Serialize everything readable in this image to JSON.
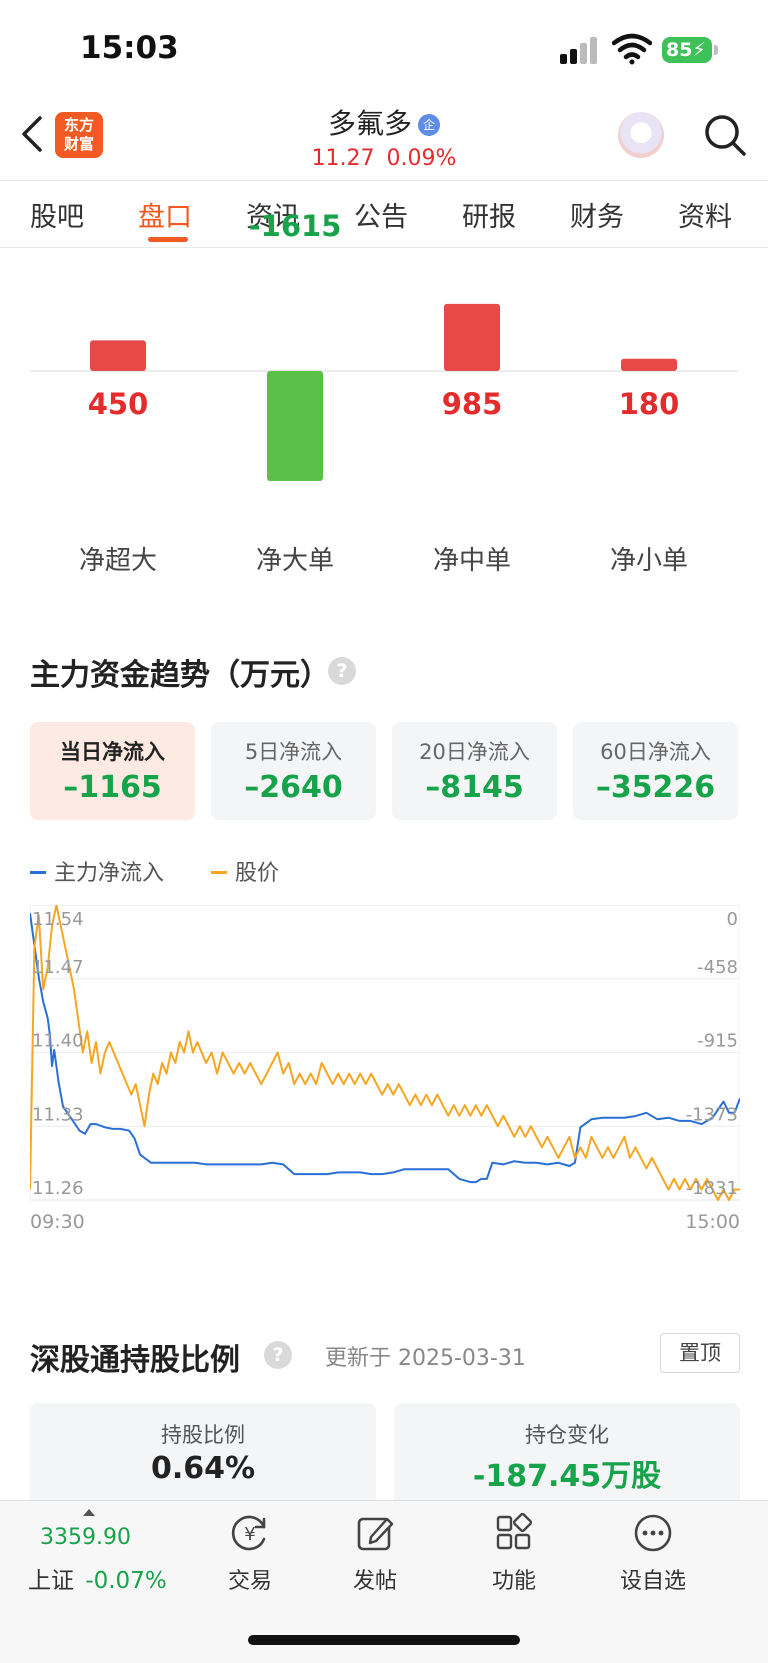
{
  "status_bar": {
    "time": "15:03",
    "battery": "85"
  },
  "header": {
    "logo_text_line1": "东方",
    "logo_text_line2": "财富",
    "stock_name": "多氟多",
    "badge": "企",
    "price": "11.27",
    "change_pct": "0.09%"
  },
  "tabs": [
    "股吧",
    "盘口",
    "资讯",
    "公告",
    "研报",
    "财务",
    "资料"
  ],
  "active_tab": "盘口",
  "order_flow": {
    "items": [
      {
        "label": "净超大",
        "value": "450"
      },
      {
        "label": "净大单",
        "value": "-1615"
      },
      {
        "label": "净中单",
        "value": "985"
      },
      {
        "label": "净小单",
        "value": "180"
      }
    ],
    "colors": {
      "positive": "#e84848",
      "negative": "#5cbf48"
    }
  },
  "trend": {
    "title": "主力资金趋势（万元）",
    "help": "?",
    "cards": [
      {
        "label": "当日净流入",
        "value": "–1165"
      },
      {
        "label": "5日净流入",
        "value": "–2640"
      },
      {
        "label": "20日净流入",
        "value": "–8145"
      },
      {
        "label": "60日净流入",
        "value": "–35226"
      }
    ],
    "legend": {
      "flow": "主力净流入",
      "price": "股价"
    }
  },
  "chart_data": {
    "type": "line",
    "x_start": "09:30",
    "x_end": "15:00",
    "left_axis_ticks": [
      "11.54",
      "11.47",
      "11.40",
      "11.33",
      "11.26"
    ],
    "right_axis_ticks": [
      "0",
      "-458",
      "-915",
      "-1373",
      "-1831"
    ],
    "y_left_range": [
      11.26,
      11.54
    ],
    "y_right_range": [
      -1831,
      0
    ],
    "series": [
      {
        "name": "主力净流入",
        "color": "#2a6fd6",
        "axis": "right",
        "points": [
          [
            0,
            -50
          ],
          [
            4,
            -250
          ],
          [
            8,
            -450
          ],
          [
            12,
            -600
          ],
          [
            16,
            -700
          ],
          [
            18,
            -800
          ],
          [
            20,
            -1000
          ],
          [
            22,
            -900
          ],
          [
            26,
            -1100
          ],
          [
            30,
            -1250
          ],
          [
            35,
            -1300
          ],
          [
            40,
            -1350
          ],
          [
            45,
            -1400
          ],
          [
            50,
            -1420
          ],
          [
            55,
            -1360
          ],
          [
            60,
            -1360
          ],
          [
            68,
            -1380
          ],
          [
            75,
            -1390
          ],
          [
            82,
            -1390
          ],
          [
            90,
            -1400
          ],
          [
            95,
            -1450
          ],
          [
            100,
            -1550
          ],
          [
            110,
            -1600
          ],
          [
            120,
            -1600
          ],
          [
            130,
            -1600
          ],
          [
            140,
            -1600
          ],
          [
            150,
            -1600
          ],
          [
            160,
            -1610
          ],
          [
            170,
            -1610
          ],
          [
            180,
            -1610
          ],
          [
            190,
            -1610
          ],
          [
            200,
            -1610
          ],
          [
            210,
            -1610
          ],
          [
            220,
            -1600
          ],
          [
            230,
            -1610
          ],
          [
            240,
            -1670
          ],
          [
            250,
            -1670
          ],
          [
            260,
            -1670
          ],
          [
            270,
            -1670
          ],
          [
            280,
            -1660
          ],
          [
            290,
            -1660
          ],
          [
            300,
            -1660
          ],
          [
            310,
            -1670
          ],
          [
            320,
            -1670
          ],
          [
            330,
            -1660
          ],
          [
            340,
            -1640
          ],
          [
            350,
            -1640
          ],
          [
            360,
            -1640
          ],
          [
            370,
            -1640
          ],
          [
            380,
            -1640
          ],
          [
            390,
            -1700
          ],
          [
            400,
            -1720
          ],
          [
            405,
            -1720
          ],
          [
            410,
            -1700
          ],
          [
            415,
            -1700
          ],
          [
            420,
            -1600
          ],
          [
            430,
            -1610
          ],
          [
            440,
            -1590
          ],
          [
            450,
            -1600
          ],
          [
            460,
            -1600
          ],
          [
            470,
            -1610
          ],
          [
            480,
            -1600
          ],
          [
            490,
            -1620
          ],
          [
            495,
            -1600
          ],
          [
            500,
            -1380
          ],
          [
            510,
            -1330
          ],
          [
            520,
            -1320
          ],
          [
            530,
            -1320
          ],
          [
            540,
            -1320
          ],
          [
            550,
            -1310
          ],
          [
            560,
            -1290
          ],
          [
            570,
            -1330
          ],
          [
            580,
            -1320
          ],
          [
            590,
            -1340
          ],
          [
            600,
            -1340
          ],
          [
            610,
            -1360
          ],
          [
            620,
            -1320
          ],
          [
            625,
            -1270
          ],
          [
            630,
            -1220
          ],
          [
            635,
            -1290
          ],
          [
            640,
            -1290
          ],
          [
            645,
            -1200
          ]
        ]
      },
      {
        "name": "股价",
        "color": "#f5a623",
        "axis": "left",
        "points": [
          [
            0,
            11.27
          ],
          [
            4,
            11.5
          ],
          [
            8,
            11.53
          ],
          [
            12,
            11.46
          ],
          [
            16,
            11.48
          ],
          [
            20,
            11.52
          ],
          [
            24,
            11.55
          ],
          [
            28,
            11.52
          ],
          [
            32,
            11.5
          ],
          [
            36,
            11.48
          ],
          [
            40,
            11.46
          ],
          [
            44,
            11.43
          ],
          [
            48,
            11.4
          ],
          [
            52,
            11.42
          ],
          [
            56,
            11.39
          ],
          [
            60,
            11.41
          ],
          [
            64,
            11.38
          ],
          [
            68,
            11.4
          ],
          [
            72,
            11.41
          ],
          [
            76,
            11.4
          ],
          [
            80,
            11.39
          ],
          [
            84,
            11.38
          ],
          [
            88,
            11.37
          ],
          [
            92,
            11.36
          ],
          [
            96,
            11.37
          ],
          [
            100,
            11.35
          ],
          [
            104,
            11.33
          ],
          [
            108,
            11.36
          ],
          [
            112,
            11.38
          ],
          [
            116,
            11.37
          ],
          [
            120,
            11.39
          ],
          [
            124,
            11.38
          ],
          [
            128,
            11.4
          ],
          [
            132,
            11.39
          ],
          [
            136,
            11.41
          ],
          [
            140,
            11.4
          ],
          [
            144,
            11.42
          ],
          [
            148,
            11.4
          ],
          [
            152,
            11.41
          ],
          [
            156,
            11.4
          ],
          [
            160,
            11.39
          ],
          [
            165,
            11.4
          ],
          [
            170,
            11.38
          ],
          [
            175,
            11.4
          ],
          [
            180,
            11.39
          ],
          [
            185,
            11.38
          ],
          [
            190,
            11.39
          ],
          [
            195,
            11.38
          ],
          [
            200,
            11.39
          ],
          [
            205,
            11.38
          ],
          [
            210,
            11.37
          ],
          [
            215,
            11.38
          ],
          [
            220,
            11.39
          ],
          [
            225,
            11.4
          ],
          [
            230,
            11.38
          ],
          [
            235,
            11.39
          ],
          [
            240,
            11.37
          ],
          [
            245,
            11.38
          ],
          [
            250,
            11.37
          ],
          [
            255,
            11.38
          ],
          [
            260,
            11.37
          ],
          [
            265,
            11.39
          ],
          [
            270,
            11.38
          ],
          [
            275,
            11.37
          ],
          [
            280,
            11.38
          ],
          [
            285,
            11.37
          ],
          [
            290,
            11.38
          ],
          [
            295,
            11.37
          ],
          [
            300,
            11.38
          ],
          [
            305,
            11.37
          ],
          [
            310,
            11.38
          ],
          [
            315,
            11.37
          ],
          [
            320,
            11.36
          ],
          [
            325,
            11.37
          ],
          [
            330,
            11.36
          ],
          [
            335,
            11.37
          ],
          [
            340,
            11.36
          ],
          [
            345,
            11.35
          ],
          [
            350,
            11.36
          ],
          [
            355,
            11.35
          ],
          [
            360,
            11.36
          ],
          [
            365,
            11.35
          ],
          [
            370,
            11.36
          ],
          [
            375,
            11.35
          ],
          [
            380,
            11.34
          ],
          [
            385,
            11.35
          ],
          [
            390,
            11.34
          ],
          [
            395,
            11.35
          ],
          [
            400,
            11.34
          ],
          [
            405,
            11.35
          ],
          [
            410,
            11.34
          ],
          [
            415,
            11.35
          ],
          [
            420,
            11.34
          ],
          [
            425,
            11.33
          ],
          [
            430,
            11.34
          ],
          [
            435,
            11.33
          ],
          [
            440,
            11.32
          ],
          [
            445,
            11.33
          ],
          [
            450,
            11.32
          ],
          [
            455,
            11.33
          ],
          [
            460,
            11.32
          ],
          [
            465,
            11.31
          ],
          [
            470,
            11.32
          ],
          [
            475,
            11.31
          ],
          [
            480,
            11.3
          ],
          [
            485,
            11.31
          ],
          [
            490,
            11.32
          ],
          [
            495,
            11.3
          ],
          [
            500,
            11.31
          ],
          [
            505,
            11.3
          ],
          [
            510,
            11.32
          ],
          [
            515,
            11.31
          ],
          [
            520,
            11.3
          ],
          [
            525,
            11.31
          ],
          [
            530,
            11.3
          ],
          [
            535,
            11.31
          ],
          [
            540,
            11.32
          ],
          [
            545,
            11.3
          ],
          [
            550,
            11.31
          ],
          [
            555,
            11.3
          ],
          [
            560,
            11.29
          ],
          [
            565,
            11.3
          ],
          [
            570,
            11.29
          ],
          [
            575,
            11.28
          ],
          [
            580,
            11.27
          ],
          [
            585,
            11.28
          ],
          [
            590,
            11.27
          ],
          [
            595,
            11.28
          ],
          [
            600,
            11.27
          ],
          [
            605,
            11.28
          ],
          [
            610,
            11.27
          ],
          [
            615,
            11.28
          ],
          [
            620,
            11.27
          ],
          [
            625,
            11.26
          ],
          [
            630,
            11.27
          ],
          [
            635,
            11.26
          ],
          [
            640,
            11.27
          ],
          [
            645,
            11.27
          ]
        ]
      }
    ]
  },
  "holdings": {
    "title": "深股通持股比例",
    "help": "?",
    "updated": "更新于 2025-03-31",
    "pin_label": "置顶",
    "ratio_label": "持股比例",
    "ratio_value": "0.64%",
    "change_label": "持仓变化",
    "change_value": "-187.45万股"
  },
  "bottom_bar": {
    "index_value": "3359.90",
    "index_name": "上证",
    "index_change": "-0.07%",
    "nav": [
      {
        "label": "交易",
        "icon": "yen-refresh-icon"
      },
      {
        "label": "发帖",
        "icon": "edit-icon"
      },
      {
        "label": "功能",
        "icon": "grid-icon"
      },
      {
        "label": "设自选",
        "icon": "more-icon"
      }
    ]
  }
}
